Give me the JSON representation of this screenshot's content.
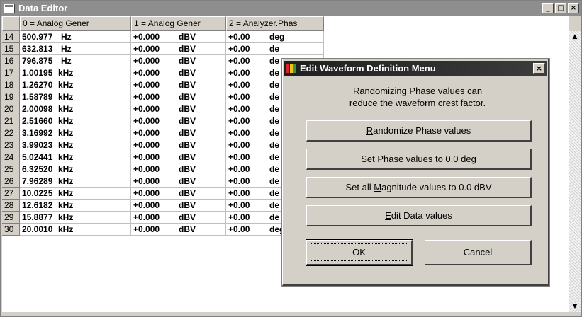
{
  "window": {
    "title": "Data Editor",
    "controls": {
      "minimize": "_",
      "maximize": "□",
      "close": "×"
    }
  },
  "grid": {
    "column_headers": [
      "0 = Analog Gener",
      "1 = Analog Gener",
      "2 = Analyzer.Phas"
    ],
    "rows": [
      {
        "num": "14",
        "freq": "500.977",
        "freq_unit": "Hz",
        "mag": "+0.000",
        "mag_unit": "dBV",
        "phase": "+0.00",
        "phase_unit": "deg"
      },
      {
        "num": "15",
        "freq": "632.813",
        "freq_unit": "Hz",
        "mag": "+0.000",
        "mag_unit": "dBV",
        "phase": "+0.00",
        "phase_unit": "de"
      },
      {
        "num": "16",
        "freq": "796.875",
        "freq_unit": "Hz",
        "mag": "+0.000",
        "mag_unit": "dBV",
        "phase": "+0.00",
        "phase_unit": "de"
      },
      {
        "num": "17",
        "freq": "1.00195",
        "freq_unit": "kHz",
        "mag": "+0.000",
        "mag_unit": "dBV",
        "phase": "+0.00",
        "phase_unit": "de"
      },
      {
        "num": "18",
        "freq": "1.26270",
        "freq_unit": "kHz",
        "mag": "+0.000",
        "mag_unit": "dBV",
        "phase": "+0.00",
        "phase_unit": "de"
      },
      {
        "num": "19",
        "freq": "1.58789",
        "freq_unit": "kHz",
        "mag": "+0.000",
        "mag_unit": "dBV",
        "phase": "+0.00",
        "phase_unit": "de"
      },
      {
        "num": "20",
        "freq": "2.00098",
        "freq_unit": "kHz",
        "mag": "+0.000",
        "mag_unit": "dBV",
        "phase": "+0.00",
        "phase_unit": "de"
      },
      {
        "num": "21",
        "freq": "2.51660",
        "freq_unit": "kHz",
        "mag": "+0.000",
        "mag_unit": "dBV",
        "phase": "+0.00",
        "phase_unit": "de"
      },
      {
        "num": "22",
        "freq": "3.16992",
        "freq_unit": "kHz",
        "mag": "+0.000",
        "mag_unit": "dBV",
        "phase": "+0.00",
        "phase_unit": "de"
      },
      {
        "num": "23",
        "freq": "3.99023",
        "freq_unit": "kHz",
        "mag": "+0.000",
        "mag_unit": "dBV",
        "phase": "+0.00",
        "phase_unit": "de"
      },
      {
        "num": "24",
        "freq": "5.02441",
        "freq_unit": "kHz",
        "mag": "+0.000",
        "mag_unit": "dBV",
        "phase": "+0.00",
        "phase_unit": "de"
      },
      {
        "num": "25",
        "freq": "6.32520",
        "freq_unit": "kHz",
        "mag": "+0.000",
        "mag_unit": "dBV",
        "phase": "+0.00",
        "phase_unit": "de"
      },
      {
        "num": "26",
        "freq": "7.96289",
        "freq_unit": "kHz",
        "mag": "+0.000",
        "mag_unit": "dBV",
        "phase": "+0.00",
        "phase_unit": "de"
      },
      {
        "num": "27",
        "freq": "10.0225",
        "freq_unit": "kHz",
        "mag": "+0.000",
        "mag_unit": "dBV",
        "phase": "+0.00",
        "phase_unit": "de"
      },
      {
        "num": "28",
        "freq": "12.6182",
        "freq_unit": "kHz",
        "mag": "+0.000",
        "mag_unit": "dBV",
        "phase": "+0.00",
        "phase_unit": "de"
      },
      {
        "num": "29",
        "freq": "15.8877",
        "freq_unit": "kHz",
        "mag": "+0.000",
        "mag_unit": "dBV",
        "phase": "+0.00",
        "phase_unit": "de"
      },
      {
        "num": "30",
        "freq": "20.0010",
        "freq_unit": "kHz",
        "mag": "+0.000",
        "mag_unit": "dBV",
        "phase": "+0.00",
        "phase_unit": "deg"
      }
    ]
  },
  "scrollbar": {
    "up_arrow": "▲",
    "down_arrow": "▼"
  },
  "dialog": {
    "title": "Edit Waveform Definition Menu",
    "close": "×",
    "info_line1": "Randomizing Phase values can",
    "info_line2": "reduce the waveform crest factor.",
    "btn_randomize": {
      "pre": "",
      "key": "R",
      "post": "andomize Phase values"
    },
    "btn_set_phase": {
      "pre": "Set ",
      "key": "P",
      "post": "hase values to 0.0 deg"
    },
    "btn_set_mag": {
      "pre": "Set all ",
      "key": "M",
      "post": "agnitude values to 0.0 dBV"
    },
    "btn_edit": {
      "pre": "",
      "key": "E",
      "post": "dit Data values"
    },
    "btn_ok": "OK",
    "btn_cancel": "Cancel",
    "icon_colors": [
      "#d9252a",
      "#f2c21b",
      "#2e9a3f"
    ]
  }
}
